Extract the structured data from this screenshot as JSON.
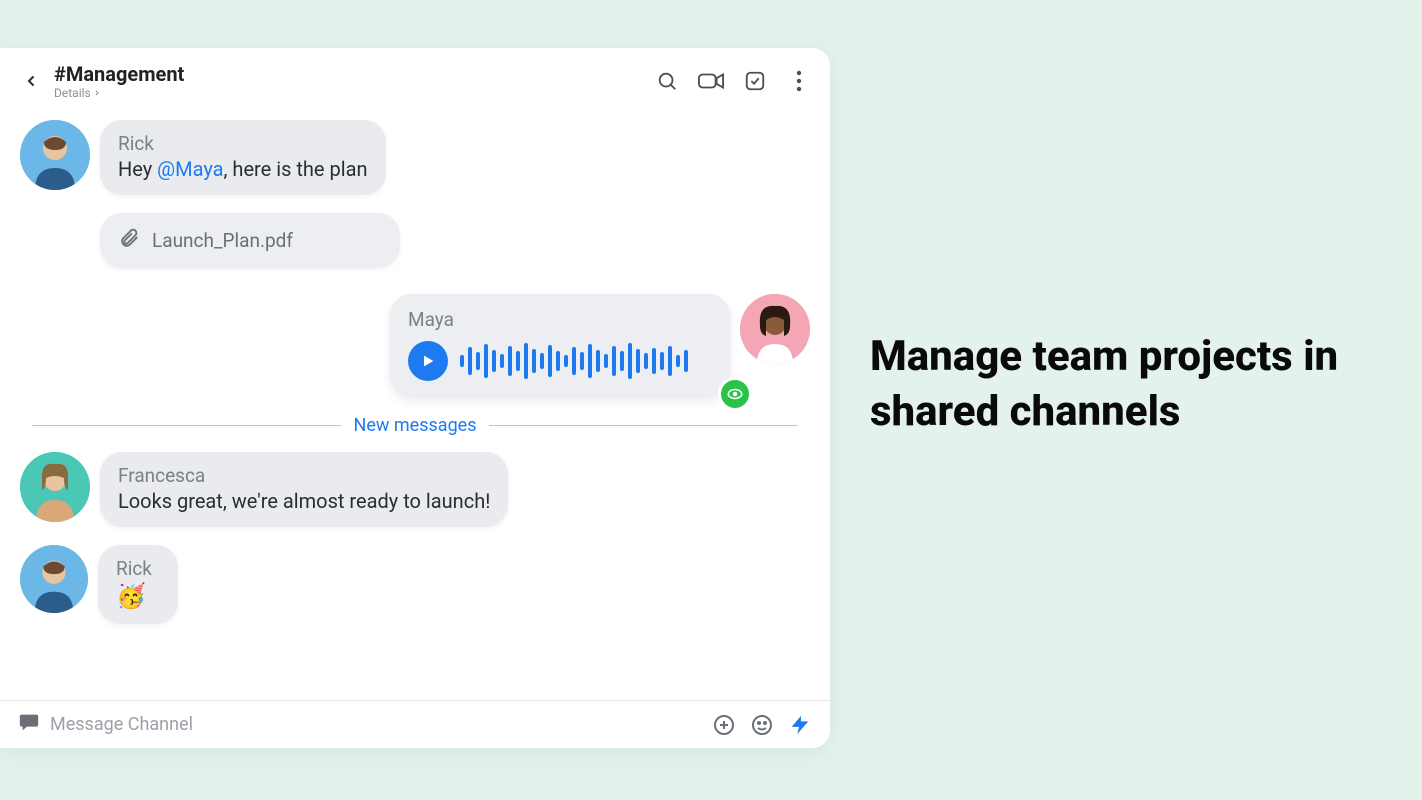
{
  "header": {
    "channel_title": "#Management",
    "details_label": "Details"
  },
  "messages": [
    {
      "id": "m1",
      "sender": "Rick",
      "text_before": "Hey ",
      "mention": "@Maya",
      "text_after": ", here is the plan",
      "attachment": "Launch_Plan.pdf"
    },
    {
      "id": "m2",
      "sender": "Maya",
      "type": "voice"
    },
    {
      "id": "m3",
      "sender": "Francesca",
      "text": "Looks great, we're almost ready to launch!"
    },
    {
      "id": "m4",
      "sender": "Rick",
      "emoji": "🥳"
    }
  ],
  "divider_label": "New messages",
  "composer": {
    "placeholder": "Message Channel"
  },
  "marketing_headline": "Manage team projects in shared channels"
}
